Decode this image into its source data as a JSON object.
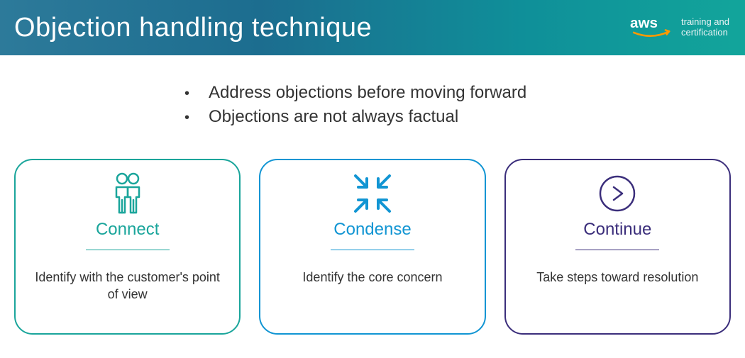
{
  "header": {
    "title": "Objection handling technique",
    "brand_primary": "aws",
    "brand_line1": "training and",
    "brand_line2": "certification"
  },
  "bullets": [
    "Address objections before moving forward",
    "Objections are not always factual"
  ],
  "cards": {
    "connect": {
      "title": "Connect",
      "desc": "Identify with the customer's point of view",
      "color": "#1aa59b"
    },
    "condense": {
      "title": "Condense",
      "desc": "Identify the core concern",
      "color": "#1195d3"
    },
    "continue": {
      "title": "Continue",
      "desc": "Take steps toward resolution",
      "color": "#3b2e7b"
    }
  }
}
